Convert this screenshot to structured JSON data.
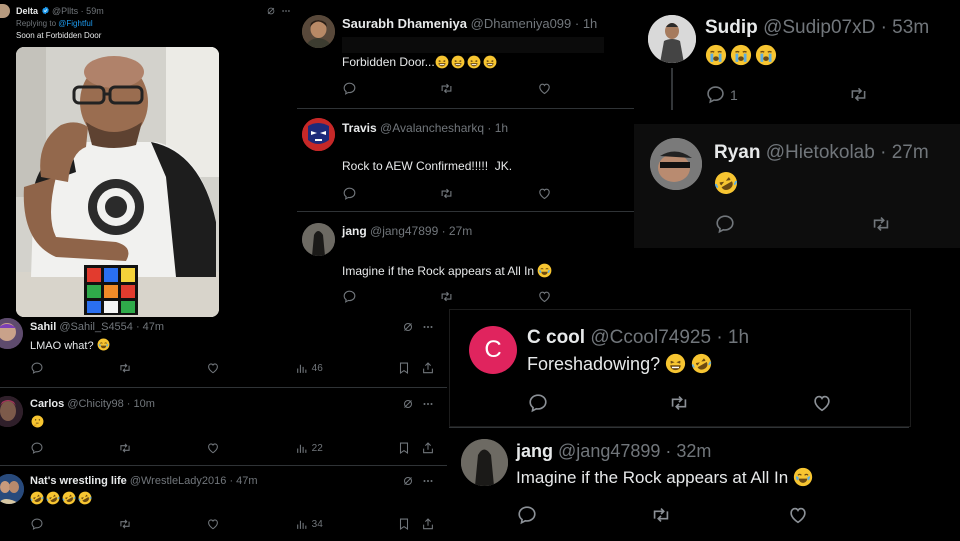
{
  "colors": {
    "bg": "#000000",
    "text": "#e7e9ea",
    "muted": "#71767b",
    "link": "#1d9bf0",
    "divider": "#2f3336",
    "verified": "#1d9bf0",
    "ccool_avatar": "#e0245e"
  },
  "p1": {
    "name": "Delta",
    "handle": "@Pllts · 59m",
    "replying": "Replying to",
    "replying_handle": "@Fightful",
    "text": "Soon at Forbidden Door"
  },
  "p2": {
    "t1": {
      "name": "Saurabh Dhameniya",
      "handle": "@Dhameniya099 · 1h",
      "text": "Forbidden Door...",
      "emoji": [
        "laugh",
        "laugh",
        "laugh",
        "laugh"
      ]
    },
    "t2": {
      "name": "Travis",
      "handle": "@Avalanchesharkq · 1h",
      "text": "Rock to AEW Confirmed!!!!!  JK."
    },
    "t3": {
      "name": "jang",
      "handle": "@jang47899 · 27m",
      "text": "Imagine if the Rock appears at All In",
      "emoji": [
        "cry-laugh"
      ]
    }
  },
  "p3": {
    "t1": {
      "name": "Sudip",
      "handle": "@Sudip07xD · 53m",
      "emoji": [
        "sob",
        "sob",
        "sob"
      ],
      "reply_count": "1"
    },
    "t2": {
      "name": "Ryan",
      "handle": "@Hietokolab · 27m",
      "emoji": [
        "rofl"
      ]
    }
  },
  "p4": {
    "t1": {
      "name": "Sahil",
      "handle": "@Sahil_S4554 · 47m",
      "text": "LMAO what?",
      "views": "46"
    },
    "t2": {
      "name": "Carlos",
      "handle": "@Chicity98 · 10m",
      "views": "22"
    },
    "t3": {
      "name": "Nat's wrestling life",
      "handle": "@WrestleLady2016 · 47m",
      "views": "34"
    }
  },
  "p5": {
    "name": "C cool",
    "handle": "@Ccool74925 · 1h",
    "avatar_letter": "C",
    "text": "Foreshadowing?"
  },
  "p6": {
    "name": "jang",
    "handle": "@jang47899 · 32m",
    "text": "Imagine if the Rock appears at All In"
  }
}
